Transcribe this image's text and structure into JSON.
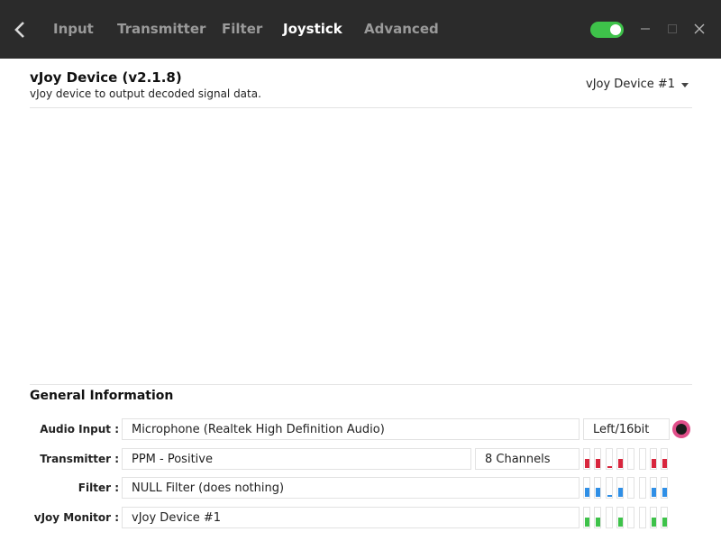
{
  "tabs": [
    {
      "label": "Input",
      "active": false
    },
    {
      "label": "Transmitter",
      "active": false
    },
    {
      "label": "Filter",
      "active": false
    },
    {
      "label": "Joystick",
      "active": true
    },
    {
      "label": "Advanced",
      "active": false
    }
  ],
  "window": {
    "enabled_toggle": true
  },
  "header": {
    "title": "vJoy Device (v2.1.8)",
    "subtitle": "vJoy device to output decoded signal data.",
    "device_selector": "vJoy Device #1"
  },
  "general": {
    "title": "General Information",
    "audio_input": {
      "label": "Audio Input :",
      "value": "Microphone (Realtek High Definition Audio)",
      "format": "Left/16bit"
    },
    "transmitter": {
      "label": "Transmitter :",
      "value": "PPM - Positive",
      "channels": "8 Channels"
    },
    "filter": {
      "label": "Filter :",
      "value": "NULL Filter (does nothing)"
    },
    "vjoy_monitor": {
      "label": "vJoy Monitor :",
      "value": "vJoy Device #1"
    }
  },
  "meters": {
    "transmitter": {
      "color": "#d8263d",
      "levels": [
        0.45,
        0.45,
        0.1,
        0.45,
        0,
        0,
        0.45,
        0.45
      ]
    },
    "filter": {
      "color": "#2f8fe6",
      "levels": [
        0.45,
        0.45,
        0.1,
        0.45,
        0,
        0,
        0.45,
        0.45
      ]
    },
    "vjoy_monitor": {
      "color": "#3ec24a",
      "levels": [
        0.45,
        0.45,
        0,
        0.45,
        0,
        0,
        0.45,
        0.45
      ]
    }
  },
  "icons": {
    "back": "chevron-left-icon",
    "minimize": "minimize-icon",
    "maximize": "maximize-icon",
    "close": "close-icon",
    "record": "record-icon"
  }
}
